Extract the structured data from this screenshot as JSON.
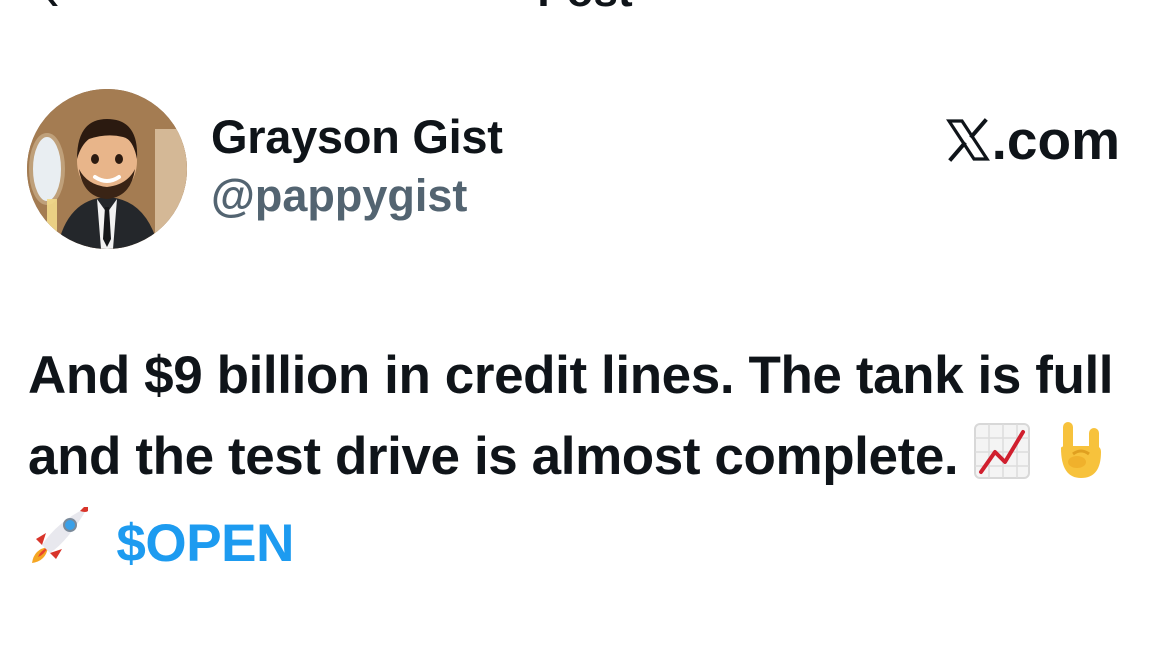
{
  "header": {
    "title": "Post",
    "back_icon": "back-arrow-icon"
  },
  "post": {
    "author": {
      "display_name": "Grayson Gist",
      "handle": "@pappygist",
      "avatar_icon": "avatar-cartoon-man-icon"
    },
    "brand": {
      "label": ".com",
      "icon": "x-logo-icon"
    },
    "text_part1": "And $9 billion in credit lines. The tank is full and the test drive is almost complete.",
    "emojis": [
      "chart-increasing-icon",
      "sign-of-the-horns-icon",
      "rocket-icon"
    ],
    "cashtag": "$OPEN"
  },
  "colors": {
    "text": "#0f1419",
    "secondary": "#536471",
    "link": "#1d9bf0",
    "background": "#ffffff"
  }
}
